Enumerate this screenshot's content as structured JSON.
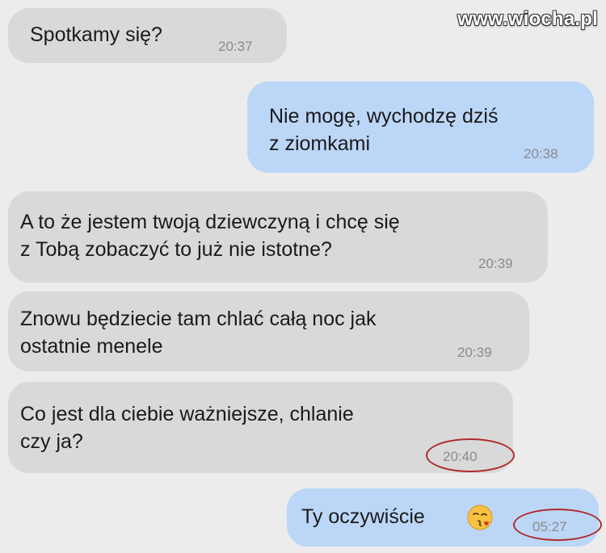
{
  "watermark": "www.wiocha.pl",
  "messages": [
    {
      "direction": "incoming",
      "text": "Spotkamy się?",
      "time": "20:37",
      "highlighted": false
    },
    {
      "direction": "outgoing",
      "text": "Nie mogę, wychodzę dziś\nz ziomkami",
      "time": "20:38",
      "highlighted": false
    },
    {
      "direction": "incoming",
      "text": "A to że jestem twoją dziewczyną i chcę się\nz Tobą zobaczyć to już nie istotne?",
      "time": "20:39",
      "highlighted": false
    },
    {
      "direction": "incoming",
      "text": "Znowu będziecie tam chlać całą noc jak\nostatnie menele",
      "time": "20:39",
      "highlighted": false
    },
    {
      "direction": "incoming",
      "text": "Co jest dla ciebie ważniejsze, chlanie\nczy ja?",
      "time": "20:40",
      "highlighted": true
    },
    {
      "direction": "outgoing",
      "text": "Ty oczywiście",
      "time": "05:27",
      "highlighted": true,
      "emoji": "kissing-face-winking-heart"
    }
  ],
  "colors": {
    "incoming_bubble": "#d9d9d9",
    "outgoing_bubble": "#bcd6f7",
    "highlight_circle": "#b02a2a",
    "background": "#ececec"
  }
}
